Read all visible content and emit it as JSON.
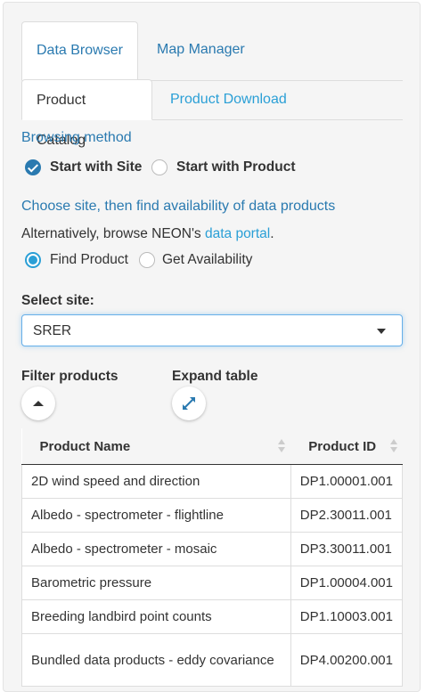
{
  "tabs": {
    "data_browser": "Data Browser",
    "map_manager": "Map Manager"
  },
  "subtabs": {
    "product_catalog": "Product Catalog",
    "product_download": "Product Download"
  },
  "browsing": {
    "heading": "Browsing method",
    "option_site": "Start with Site",
    "option_product": "Start with Product",
    "selected": "Start with Site"
  },
  "choose": {
    "heading": "Choose site, then find availability of data products",
    "alt_prefix": "Alternatively, browse NEON's ",
    "alt_link": "data portal",
    "alt_suffix": ".",
    "option_find": "Find Product",
    "option_avail": "Get Availability",
    "selected": "Find Product"
  },
  "site": {
    "label": "Select site:",
    "value": "SRER"
  },
  "filter_label": "Filter products",
  "expand_label": "Expand table",
  "table": {
    "headers": [
      "Product Name",
      "Product ID"
    ],
    "rows": [
      [
        "2D wind speed and direction",
        "DP1.00001.001"
      ],
      [
        "Albedo - spectrometer - flightline",
        "DP2.30011.001"
      ],
      [
        "Albedo - spectrometer - mosaic",
        "DP3.30011.001"
      ],
      [
        "Barometric pressure",
        "DP1.00004.001"
      ],
      [
        "Breeding landbird point counts",
        "DP1.10003.001"
      ],
      [
        "Bundled data products - eddy covariance",
        "DP4.00200.001"
      ]
    ]
  },
  "icons": {
    "filter": "chevron-up-icon",
    "expand": "expand-arrows-icon"
  },
  "colors": {
    "accent": "#2a7ab0",
    "link": "#2a9fd6"
  }
}
